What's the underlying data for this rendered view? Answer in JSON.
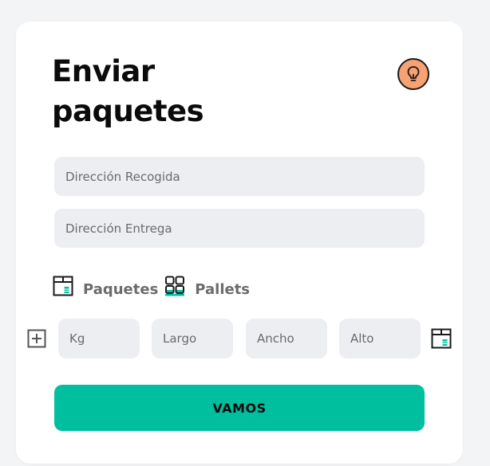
{
  "header": {
    "title_line1": "Enviar",
    "title_line2": "paquetes",
    "help_icon": "lightbulb-icon"
  },
  "form": {
    "pickup": {
      "placeholder": "Dirección Recogida",
      "value": ""
    },
    "delivery": {
      "placeholder": "Dirección Entrega",
      "value": ""
    }
  },
  "shipment_types": [
    {
      "label": "Paquetes",
      "icon": "package-icon"
    },
    {
      "label": "Pallets",
      "icon": "pallets-icon"
    }
  ],
  "dimensions": {
    "add_icon": "plus-square-icon",
    "kg": {
      "placeholder": "Kg"
    },
    "largo": {
      "placeholder": "Largo"
    },
    "ancho": {
      "placeholder": "Ancho"
    },
    "alto": {
      "placeholder": "Alto"
    },
    "end_icon": "package-icon"
  },
  "submit": {
    "label": "VAMOS"
  },
  "colors": {
    "accent": "#00bf9f",
    "highlight": "#b3ebe1",
    "bulb": "#f7a274",
    "input_bg": "#eceef1",
    "page_bg": "#f3f4f6"
  }
}
